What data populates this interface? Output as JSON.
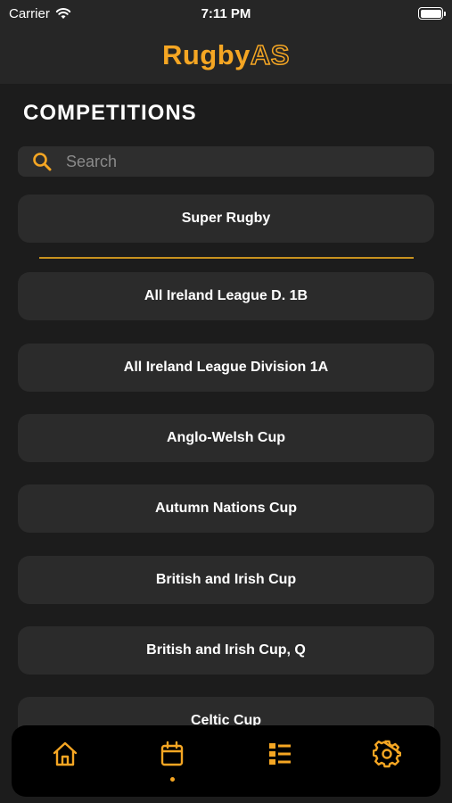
{
  "status_bar": {
    "carrier": "Carrier",
    "time": "7:11 PM"
  },
  "header": {
    "logo_part1": "Rugby",
    "logo_part2": "AS"
  },
  "page": {
    "title": "COMPETITIONS"
  },
  "search": {
    "placeholder": "Search"
  },
  "featured": {
    "label": "Super Rugby"
  },
  "competitions": [
    "All Ireland League D. 1B",
    "All Ireland League Division 1A",
    "Anglo-Welsh Cup",
    "Autumn Nations Cup",
    "British and Irish Cup",
    "British and Irish Cup, Q",
    "Celtic Cup"
  ],
  "tabs": [
    {
      "icon": "home-icon",
      "active": false
    },
    {
      "icon": "calendar-icon",
      "active": true
    },
    {
      "icon": "list-icon",
      "active": false
    },
    {
      "icon": "settings-gear-icon",
      "active": false
    }
  ],
  "colors": {
    "accent": "#f5a623",
    "background": "#1c1c1c",
    "card": "#2b2b2b",
    "header": "#262626"
  }
}
